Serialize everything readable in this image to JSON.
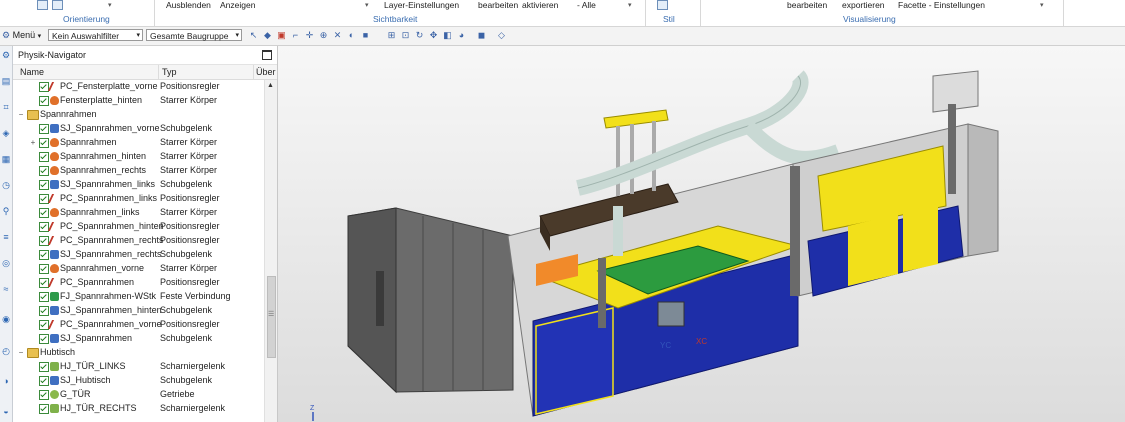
{
  "ribbon": {
    "orientation_group": "Orientierung",
    "ausblenden": "Ausblenden",
    "anzeigen": "Anzeigen",
    "layer_einstellungen": "Layer-Einstellungen",
    "bearbeiten1": "bearbeiten",
    "aktivieren": "aktivieren",
    "alle": "- Alle",
    "sichtbarkeit_group": "Sichtbarkeit",
    "stil_group": "Stil",
    "bearbeiten2": "bearbeiten",
    "exportieren": "exportieren",
    "facette": "Facette - Einstellungen",
    "visualisierung_group": "Visualisierung"
  },
  "quickbar": {
    "menu": "Menü",
    "filter": "Kein Auswahlfilter",
    "scope": "Gesamte Baugruppe"
  },
  "navigator": {
    "title": "Physik-Navigator",
    "columns": {
      "name": "Name",
      "type": "Typ",
      "overflow": "Über"
    },
    "rows": [
      {
        "name": "PC_Fensterplatte_vorne",
        "type": "Positionsregler",
        "icon": "pc"
      },
      {
        "name": "Fensterplatte_hinten",
        "type": "Starrer Körper",
        "icon": "sk"
      },
      {
        "name": "Spannrahmen",
        "type": "",
        "icon": "folder",
        "group": true
      },
      {
        "name": "SJ_Spannrahmen_vorne",
        "type": "Schubgelenk",
        "icon": "sj"
      },
      {
        "name": "Spannrahmen",
        "type": "Starrer Körper",
        "icon": "sk",
        "expand": "+"
      },
      {
        "name": "Spannrahmen_hinten",
        "type": "Starrer Körper",
        "icon": "sk"
      },
      {
        "name": "Spannrahmen_rechts",
        "type": "Starrer Körper",
        "icon": "sk"
      },
      {
        "name": "SJ_Spannrahmen_links",
        "type": "Schubgelenk",
        "icon": "sj"
      },
      {
        "name": "PC_Spannrahmen_links",
        "type": "Positionsregler",
        "icon": "pc"
      },
      {
        "name": "Spannrahmen_links",
        "type": "Starrer Körper",
        "icon": "sk"
      },
      {
        "name": "PC_Spannrahmen_hinten",
        "type": "Positionsregler",
        "icon": "pc"
      },
      {
        "name": "PC_Spannrahmen_rechts",
        "type": "Positionsregler",
        "icon": "pc"
      },
      {
        "name": "SJ_Spannrahmen_rechts",
        "type": "Schubgelenk",
        "icon": "sj"
      },
      {
        "name": "Spannrahmen_vorne",
        "type": "Starrer Körper",
        "icon": "sk"
      },
      {
        "name": "PC_Spannrahmen",
        "type": "Positionsregler",
        "icon": "pc"
      },
      {
        "name": "FJ_Spannrahmen-WStk",
        "type": "Feste Verbindung",
        "icon": "fj"
      },
      {
        "name": "SJ_Spannrahmen_hinten",
        "type": "Schubgelenk",
        "icon": "sj"
      },
      {
        "name": "PC_Spannrahmen_vorne",
        "type": "Positionsregler",
        "icon": "pc"
      },
      {
        "name": "SJ_Spannrahmen",
        "type": "Schubgelenk",
        "icon": "sj"
      },
      {
        "name": "Hubtisch",
        "type": "",
        "icon": "folder",
        "group": true
      },
      {
        "name": "HJ_TÜR_LINKS",
        "type": "Scharniergelenk",
        "icon": "hj"
      },
      {
        "name": "SJ_Hubtisch",
        "type": "Schubgelenk",
        "icon": "sj"
      },
      {
        "name": "G_TÜR",
        "type": "Getriebe",
        "icon": "gt"
      },
      {
        "name": "HJ_TÜR_RECHTS",
        "type": "Scharniergelenk",
        "icon": "hj"
      }
    ]
  },
  "viewport": {
    "axis_yc": "YC",
    "axis_xc": "XC",
    "triad_z": "Z"
  },
  "colors": {
    "machine_blue": "#1e2ea8",
    "machine_yellow": "#f2e01a",
    "frame_grey": "#c9c9c9"
  }
}
